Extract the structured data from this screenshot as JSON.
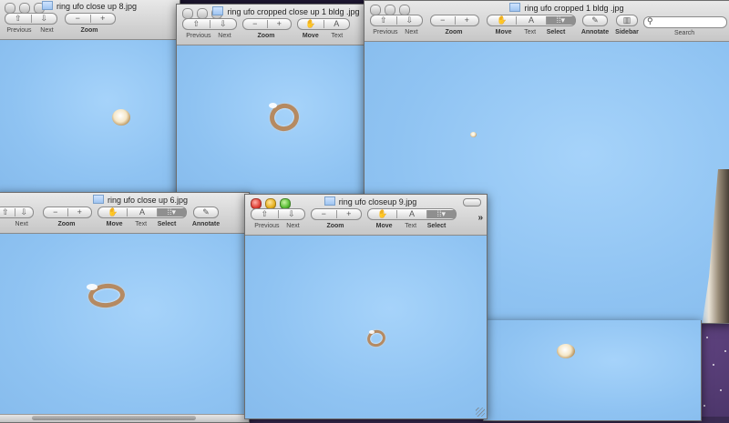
{
  "windows": {
    "w1": {
      "title": "ring ufo close up 8.jpg",
      "tools": {
        "previous": "Previous",
        "next": "Next",
        "zoom": "Zoom"
      }
    },
    "w2": {
      "title": "ring ufo cropped  close up 1 bldg .jpg",
      "tools": {
        "previous": "Previous",
        "next": "Next",
        "zoom": "Zoom",
        "move": "Move",
        "text": "Text"
      }
    },
    "w3": {
      "title": "ring ufo cropped 1 bldg .jpg",
      "tools": {
        "previous": "Previous",
        "next": "Next",
        "zoom": "Zoom",
        "move": "Move",
        "text": "Text",
        "select": "Select",
        "annotate": "Annotate",
        "sidebar": "Sidebar",
        "search": "Search"
      },
      "search_value": ""
    },
    "w4": {
      "title": "ring ufo close up 6.jpg",
      "tools": {
        "next": "Next",
        "zoom": "Zoom",
        "move": "Move",
        "text": "Text",
        "select": "Select",
        "annotate": "Annotate"
      }
    },
    "w5": {
      "title": "ring ufo  closeup 9.jpg",
      "tools": {
        "previous": "Previous",
        "next": "Next",
        "zoom": "Zoom",
        "move": "Move",
        "text": "Text",
        "select": "Select"
      },
      "overflow": "»"
    }
  },
  "icons": {
    "previous": "up-arrow-icon",
    "next": "down-arrow-icon",
    "zoom_out": "minus-icon",
    "zoom_in": "plus-icon",
    "move": "hand-icon",
    "text": "text-cursor-icon",
    "select": "selection-grid-icon",
    "annotate": "pencil-icon",
    "sidebar": "sidebar-icon",
    "search": "search-icon"
  },
  "colors": {
    "sky": "#8fc3f2",
    "toolbar": "#d6d6d6",
    "desktop": "#2b2045"
  }
}
